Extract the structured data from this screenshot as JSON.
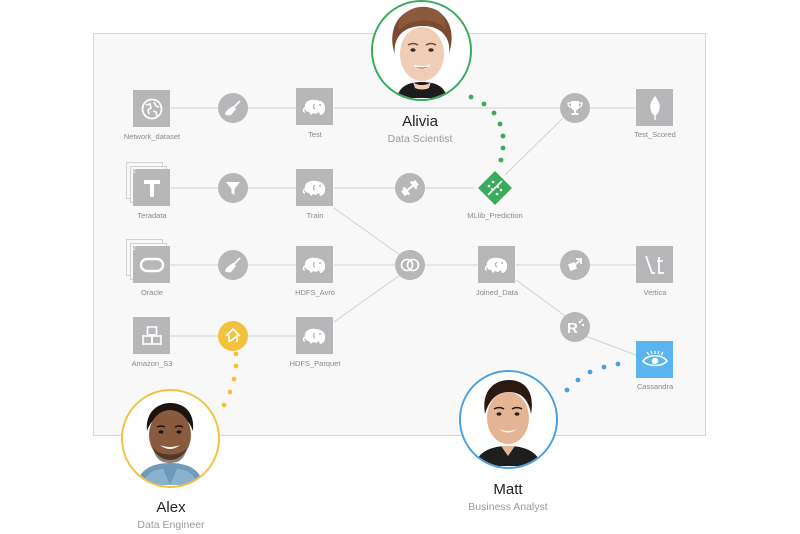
{
  "people": {
    "alivia": {
      "name": "Alivia",
      "role": "Data Scientist",
      "ring_color": "#3aaa5c"
    },
    "alex": {
      "name": "Alex",
      "role": "Data Engineer",
      "ring_color": "#f2c23c"
    },
    "matt": {
      "name": "Matt",
      "role": "Business Analyst",
      "ring_color": "#4a9fe0"
    }
  },
  "nodes": {
    "network_dataset": {
      "label": "Network_dataset",
      "icon": "globe-icon"
    },
    "test": {
      "label": "Test",
      "icon": "hadoop-elephant-icon"
    },
    "test_scored": {
      "label": "Test_Scored",
      "icon": "leaf-icon"
    },
    "teradata": {
      "label": "Teradata",
      "icon": "teradata-icon",
      "badge": "2"
    },
    "train": {
      "label": "Train",
      "icon": "hadoop-elephant-icon"
    },
    "mllib_prediction": {
      "label": "MLlib_Prediction",
      "icon": "prediction-icon"
    },
    "oracle": {
      "label": "Oracle",
      "icon": "oracle-icon",
      "badge": "2"
    },
    "hdfs_avro": {
      "label": "HDFS_Avro",
      "icon": "hadoop-elephant-icon"
    },
    "joined_data": {
      "label": "Joined_Data",
      "icon": "hadoop-elephant-icon"
    },
    "vertica": {
      "label": "Vertica",
      "icon": "vertica-icon"
    },
    "amazon_s3": {
      "label": "Amazon_S3",
      "icon": "cubes-icon"
    },
    "hdfs_parquet": {
      "label": "HDFS_Parquet",
      "icon": "hadoop-elephant-icon"
    },
    "cassandra": {
      "label": "Cassandra",
      "icon": "cassandra-eye-icon"
    }
  },
  "recipes": {
    "clean_1": {
      "icon": "broom-icon"
    },
    "filter": {
      "icon": "funnel-icon"
    },
    "train": {
      "icon": "dumbbell-icon"
    },
    "score": {
      "icon": "trophy-icon"
    },
    "clean_2": {
      "icon": "broom-icon"
    },
    "join": {
      "icon": "join-rings-icon"
    },
    "export": {
      "icon": "export-icon"
    },
    "sync": {
      "icon": "sync-icon"
    },
    "r_script": {
      "icon": "r-icon"
    }
  },
  "colors": {
    "node_gray": "#b7b7ba",
    "link_gray": "#d2d2d5",
    "green": "#3aaa5c",
    "yellow": "#f2c23c",
    "blue": "#4a9fe0",
    "cassandra_blue": "#5ab4f0"
  }
}
